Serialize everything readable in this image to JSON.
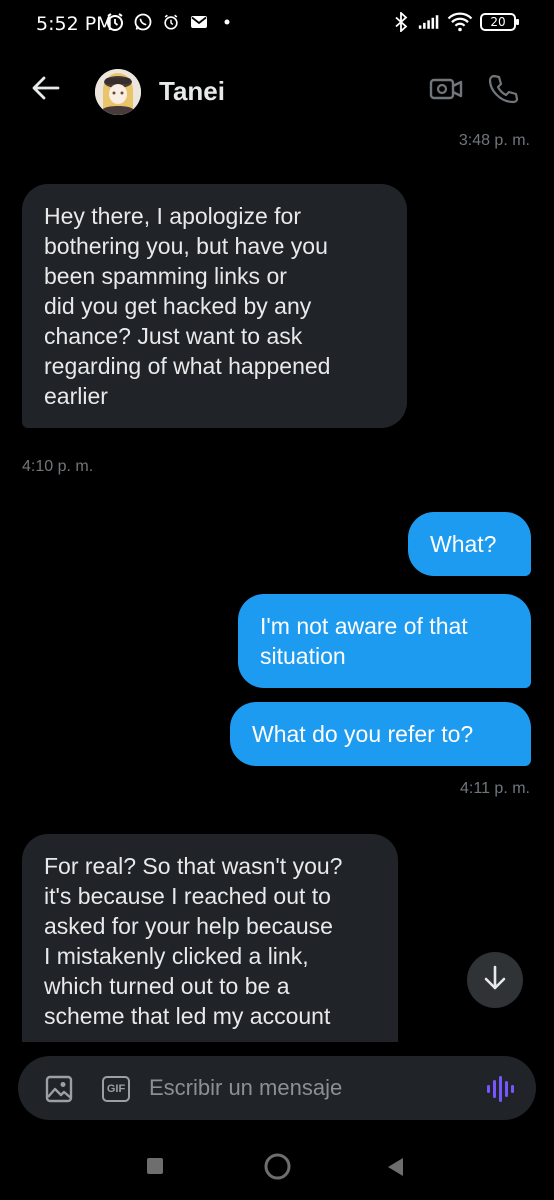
{
  "status_bar": {
    "time": "5:52 PM",
    "battery_level": "20",
    "icons": [
      "alarm-icon",
      "whatsapp-icon",
      "alarm-icon",
      "gmail-icon",
      "dot-icon",
      "bluetooth-icon",
      "signal-icon",
      "wifi-icon",
      "battery-icon"
    ]
  },
  "header": {
    "contact_name": "Tanei",
    "icons": [
      "back-arrow-icon",
      "video-call-icon",
      "phone-icon"
    ]
  },
  "messages": [
    {
      "type": "timestamp",
      "text": "3:48 p. m.",
      "align": "right"
    },
    {
      "type": "incoming",
      "lines": [
        "Hey there, I apologize for",
        "bothering you, but have you",
        "been spamming links or",
        "did you get hacked by any",
        "chance? Just want to ask",
        "regarding of what happened",
        "earlier"
      ]
    },
    {
      "type": "timestamp",
      "text": "4:10 p. m.",
      "align": "left"
    },
    {
      "type": "outgoing",
      "lines": [
        "What?"
      ]
    },
    {
      "type": "outgoing",
      "lines": [
        "I'm not aware of that",
        "situation"
      ]
    },
    {
      "type": "outgoing",
      "lines": [
        "What do you refer to?"
      ]
    },
    {
      "type": "timestamp",
      "text": "4:11 p. m.",
      "align": "right"
    },
    {
      "type": "incoming",
      "lines": [
        "For real? So that wasn't you?",
        "it's because I reached out to",
        "asked for your help because",
        "I mistakenly clicked a link,",
        "which turned out to be a",
        "scheme that led my account"
      ]
    }
  ],
  "composer": {
    "placeholder": "Escribir un mensaje",
    "gif_label": "GIF"
  },
  "colors": {
    "background": "#000000",
    "incoming_bubble": "#202327",
    "outgoing_bubble": "#1d9bf0",
    "timestamp": "#71767b",
    "voice_accent": "#7856ff"
  }
}
